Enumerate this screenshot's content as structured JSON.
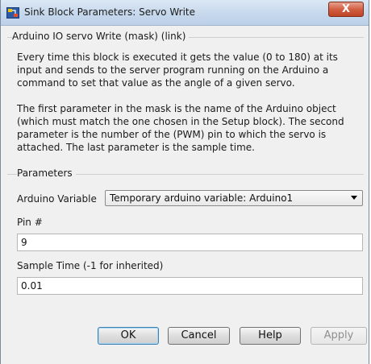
{
  "window": {
    "title": "Sink Block Parameters: Servo Write",
    "close_glyph": "X"
  },
  "mask_section": {
    "header": "Arduino IO servo Write (mask) (link)",
    "description_1": [
      "Every time this block is executed it gets the value (0 to 180) at its",
      "input and sends to the server program running on the Arduino a",
      "command to set that value as the angle of a given servo."
    ],
    "description_2": [
      "The first parameter in the mask is the name of the Arduino object",
      "(which must match the one chosen in the Setup block). The second",
      "parameter is the number of the (PWM) pin to which the servo is",
      "attached. The last parameter is the sample time."
    ]
  },
  "parameters": {
    "header": "Parameters",
    "arduino_variable_label": "Arduino Variable",
    "arduino_variable_value": "Temporary arduino variable: Arduino1",
    "pin_label": "Pin #",
    "pin_value": "9",
    "sample_time_label": "Sample Time (-1 for inherited)",
    "sample_time_value": "0.01"
  },
  "buttons": {
    "ok": "OK",
    "cancel": "Cancel",
    "help": "Help",
    "apply": "Apply"
  }
}
